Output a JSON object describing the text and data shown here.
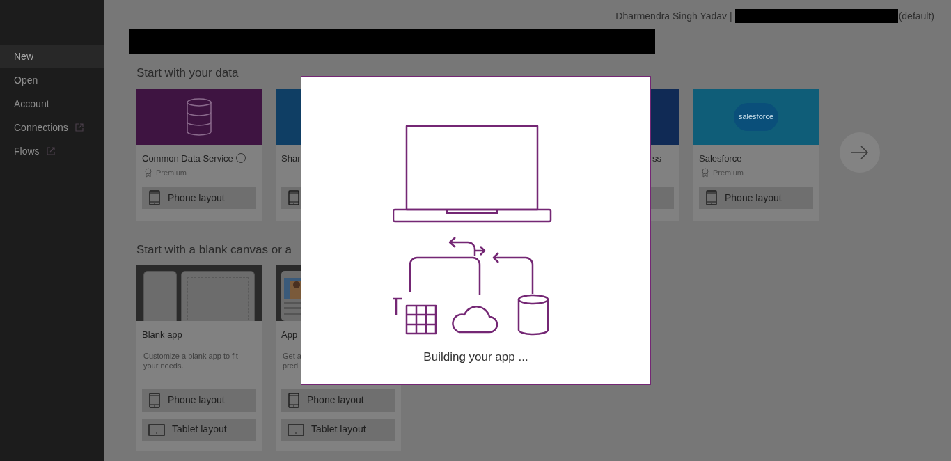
{
  "sidebar": {
    "items": [
      {
        "label": "New",
        "selected": true,
        "external": false
      },
      {
        "label": "Open",
        "selected": false,
        "external": false
      },
      {
        "label": "Account",
        "selected": false,
        "external": false
      },
      {
        "label": "Connections",
        "selected": false,
        "external": true
      },
      {
        "label": "Flows",
        "selected": false,
        "external": true
      }
    ]
  },
  "header": {
    "user": "Dharmendra Singh Yadav |",
    "suffix": "(default)"
  },
  "data_section": {
    "title": "Start with your data",
    "cards": [
      {
        "kind": "database",
        "color": "#3e1441",
        "title": "Common Data Service",
        "help": true,
        "badge": "Premium",
        "buttons": [
          {
            "kind": "phone",
            "label": "Phone layout"
          }
        ]
      },
      {
        "kind": "plain",
        "color": "#0f3e64",
        "title": "Shar",
        "buttons": [
          {
            "kind": "phone"
          }
        ]
      },
      {
        "kind": "hidden"
      },
      {
        "kind": "clipped",
        "color": "#102a55",
        "title": "ss",
        "buttons": [
          {
            "kind": "stub"
          }
        ]
      },
      {
        "kind": "salesforce",
        "color": "#0f5d78",
        "logo": "salesforce",
        "title": "Salesforce",
        "badge": "Premium",
        "buttons": [
          {
            "kind": "phone",
            "label": "Phone layout"
          }
        ]
      }
    ]
  },
  "blank_section": {
    "title": "Start with a blank canvas or a",
    "cards": [
      {
        "kind": "blank_canvas",
        "title": "Blank app",
        "description": "Customize a blank app to fit your needs.",
        "buttons": [
          {
            "kind": "phone",
            "label": "Phone layout"
          },
          {
            "kind": "tablet",
            "label": "Tablet layout"
          }
        ]
      },
      {
        "kind": "picture",
        "title": "App",
        "description": "Get a pred",
        "buttons": [
          {
            "kind": "phone",
            "label": "Phone layout"
          },
          {
            "kind": "tablet",
            "label": "Tablet layout"
          }
        ]
      }
    ]
  },
  "dialog": {
    "message": "Building your app ..."
  }
}
